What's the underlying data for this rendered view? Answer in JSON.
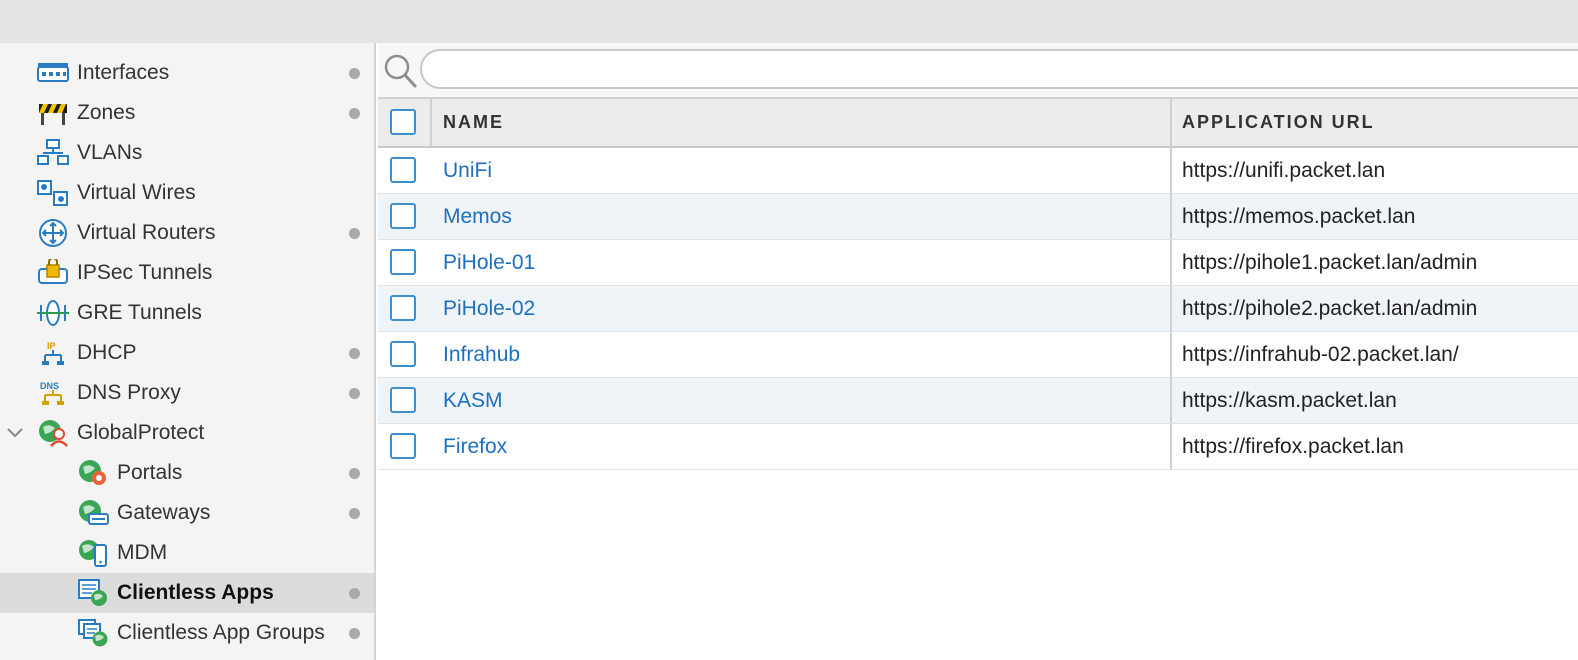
{
  "sidebar": {
    "items": [
      {
        "label": "Interfaces",
        "icon": "interfaces-icon",
        "dot": true
      },
      {
        "label": "Zones",
        "icon": "zones-icon",
        "dot": true
      },
      {
        "label": "VLANs",
        "icon": "vlans-icon",
        "dot": false
      },
      {
        "label": "Virtual Wires",
        "icon": "virtual-wires-icon",
        "dot": false
      },
      {
        "label": "Virtual Routers",
        "icon": "virtual-routers-icon",
        "dot": true
      },
      {
        "label": "IPSec Tunnels",
        "icon": "ipsec-tunnels-icon",
        "dot": false
      },
      {
        "label": "GRE Tunnels",
        "icon": "gre-tunnels-icon",
        "dot": false
      },
      {
        "label": "DHCP",
        "icon": "dhcp-icon",
        "dot": true
      },
      {
        "label": "DNS Proxy",
        "icon": "dns-proxy-icon",
        "dot": true
      },
      {
        "label": "GlobalProtect",
        "icon": "globalprotect-icon",
        "dot": false
      },
      {
        "label": "Portals",
        "icon": "portals-icon",
        "dot": true
      },
      {
        "label": "Gateways",
        "icon": "gateways-icon",
        "dot": true
      },
      {
        "label": "MDM",
        "icon": "mdm-icon",
        "dot": false
      },
      {
        "label": "Clientless Apps",
        "icon": "clientless-apps-icon",
        "dot": true,
        "selected": true
      },
      {
        "label": "Clientless App Groups",
        "icon": "clientless-app-groups-icon",
        "dot": true
      }
    ]
  },
  "search": {
    "placeholder": ""
  },
  "table": {
    "columns": [
      "NAME",
      "APPLICATION URL"
    ],
    "rows": [
      {
        "name": "UniFi",
        "url": "https://unifi.packet.lan"
      },
      {
        "name": "Memos",
        "url": "https://memos.packet.lan"
      },
      {
        "name": "PiHole-01",
        "url": "https://pihole1.packet.lan/admin"
      },
      {
        "name": "PiHole-02",
        "url": "https://pihole2.packet.lan/admin"
      },
      {
        "name": "Infrahub",
        "url": "https://infrahub-02.packet.lan/"
      },
      {
        "name": "KASM",
        "url": "https://kasm.packet.lan"
      },
      {
        "name": "Firefox",
        "url": "https://firefox.packet.lan"
      }
    ]
  },
  "colors": {
    "link": "#1f6fbf",
    "checkbox": "#3f8ed0",
    "selected_bg": "#dcdcdc",
    "row_alt": "#eef4f7"
  }
}
